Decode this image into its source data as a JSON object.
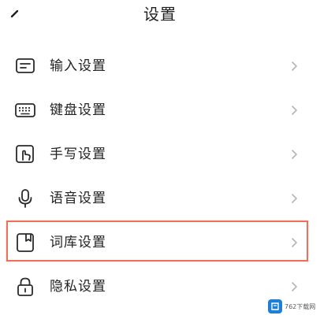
{
  "header": {
    "title": "设置",
    "back_icon": "back-arrow-icon"
  },
  "settings": {
    "items": [
      {
        "label": "输入设置",
        "icon": "input-method-icon",
        "highlighted": false
      },
      {
        "label": "键盘设置",
        "icon": "keyboard-icon",
        "highlighted": false
      },
      {
        "label": "手写设置",
        "icon": "handwriting-icon",
        "highlighted": false
      },
      {
        "label": "语音设置",
        "icon": "microphone-icon",
        "highlighted": false
      },
      {
        "label": "词库设置",
        "icon": "dictionary-icon",
        "highlighted": true
      },
      {
        "label": "隐私设置",
        "icon": "lock-icon",
        "highlighted": false
      }
    ]
  },
  "colors": {
    "highlight_border": "#e8735a",
    "text": "#222222",
    "chevron": "#b5b5b5",
    "watermark": "#1d7fd6"
  },
  "watermark": {
    "text": "762下载网"
  }
}
